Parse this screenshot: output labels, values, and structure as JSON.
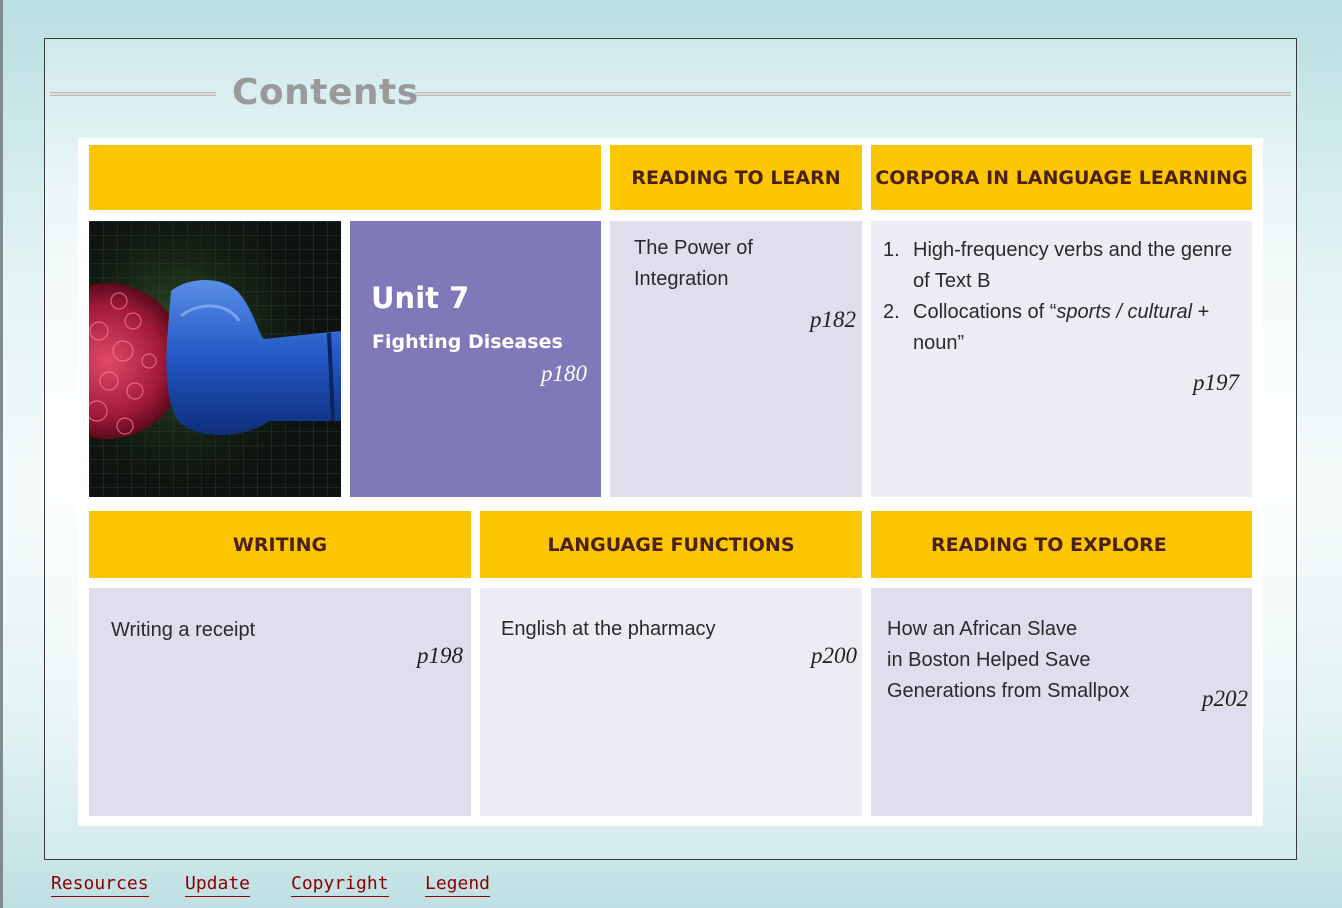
{
  "header": {
    "title": "Contents"
  },
  "unit": {
    "title": "Unit 7",
    "subtitle": "Fighting Diseases",
    "page": "p180",
    "image_icon": "boxing-glove-vs-virus-image"
  },
  "sections": {
    "reading_to_learn": {
      "heading": "READING TO LEARN",
      "text_line1": "The Power of",
      "text_line2": "Integration",
      "page": "p182"
    },
    "corpora": {
      "heading": "CORPORA IN LANGUAGE LEARNING",
      "items": [
        {
          "num": "1.",
          "line1": "High-frequency verbs and the genre",
          "line2": "of Text B"
        },
        {
          "num": "2.",
          "line1_pre": "Collocations of “",
          "line1_italic": "sports / cultural",
          "line1_post": " +",
          "line2": "noun”"
        }
      ],
      "page": "p197"
    },
    "writing": {
      "heading": "WRITING",
      "text": "Writing a receipt",
      "page": "p198"
    },
    "language_functions": {
      "heading": "LANGUAGE FUNCTIONS",
      "text": "English at the pharmacy",
      "page": "p200"
    },
    "reading_to_explore": {
      "heading": "READING TO EXPLORE",
      "lines": [
        "How an African Slave",
        "in Boston Helped Save",
        "Generations from Smallpox"
      ],
      "page": "p202"
    }
  },
  "footer": {
    "links": [
      "Resources",
      "Update",
      "Copyright",
      "Legend"
    ]
  },
  "colors": {
    "heading_bg": "#fcc603",
    "heading_text": "#4a2114",
    "unit_bg": "#8079b9",
    "cell_bg": "#e1ddec",
    "link": "#8b0000"
  }
}
